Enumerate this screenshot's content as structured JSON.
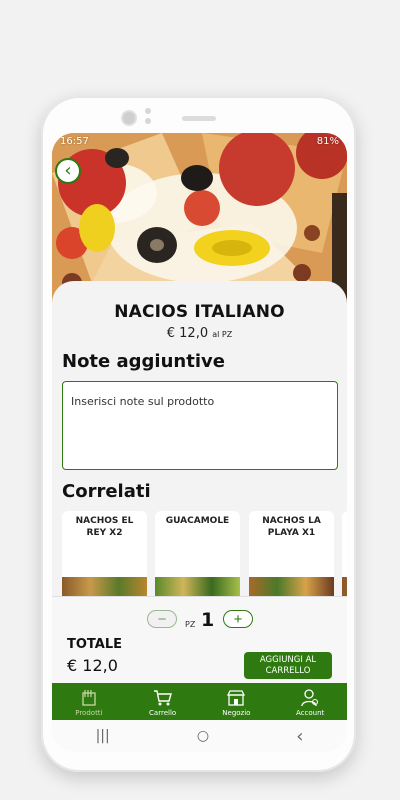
{
  "status_bar": {
    "time": "16:57",
    "battery": "81%"
  },
  "product": {
    "name": "NACIOS ITALIANO",
    "price": "€ 12,0",
    "price_unit": "al PZ"
  },
  "notes": {
    "title": "Note aggiuntive",
    "placeholder": "Inserisci note sul prodotto"
  },
  "related": {
    "title": "Correlati",
    "items": [
      {
        "name": "NACHOS EL REY X2"
      },
      {
        "name": "GUACAMOLE"
      },
      {
        "name": "NACHOS LA PLAYA X1"
      }
    ]
  },
  "quantity": {
    "unit": "PZ",
    "value": "1",
    "minus": "−",
    "plus": "+"
  },
  "total": {
    "label": "TOTALE",
    "value": "€ 12,0"
  },
  "add_to_cart": "AGGIUNGI AL CARRELLO",
  "nav": [
    {
      "label": "Prodotti",
      "icon": "food-icon",
      "active": true
    },
    {
      "label": "Carrello",
      "icon": "cart-icon"
    },
    {
      "label": "Negozio",
      "icon": "store-icon"
    },
    {
      "label": "Account",
      "icon": "account-icon"
    }
  ],
  "system_nav": {
    "recents": "|||",
    "home": "○",
    "back": "‹"
  },
  "colors": {
    "accent": "#2e7a10",
    "background": "#f3f3f3"
  }
}
